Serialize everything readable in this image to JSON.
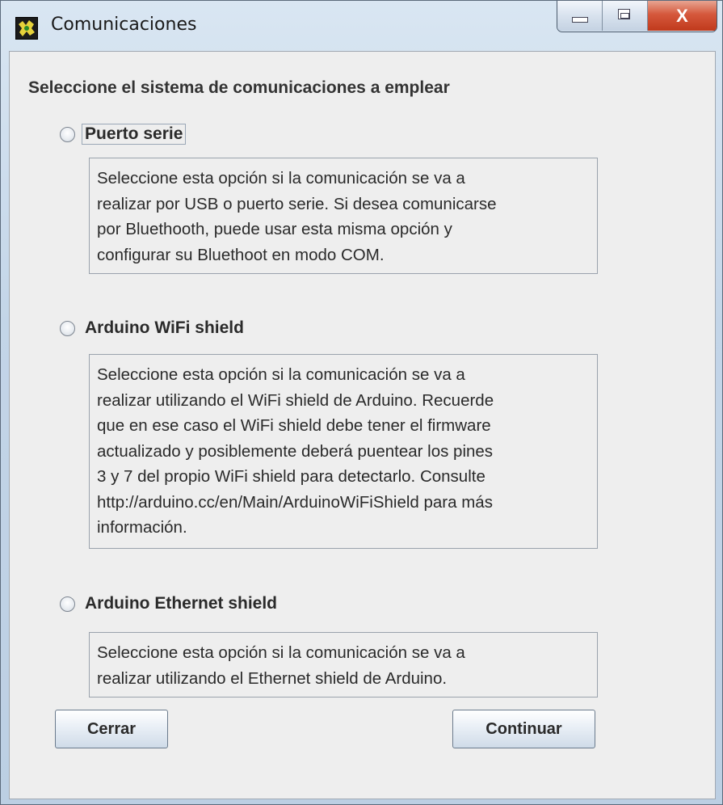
{
  "window": {
    "title": "Comunicaciones",
    "controls": {
      "close_label": "X"
    }
  },
  "dialog": {
    "heading": "Seleccione el sistema de comunicaciones a emplear",
    "options": [
      {
        "label": "Puerto serie",
        "selected": false,
        "description": "Seleccione esta opción si la comunicación se va a\nrealizar por USB o puerto serie. Si desea comunicarse\npor Bluethooth, puede usar esta misma opción y\nconfigurar su Bluethoot en modo COM."
      },
      {
        "label": "Arduino WiFi shield",
        "selected": false,
        "description": "Seleccione esta opción si la comunicación se va a\nrealizar utilizando el WiFi shield de Arduino. Recuerde\nque en ese caso el WiFi shield debe tener el firmware\nactualizado y posiblemente deberá puentear los pines\n3 y 7 del propio WiFi shield para detectarlo. Consulte\nhttp://arduino.cc/en/Main/ArduinoWiFiShield para más\ninformación."
      },
      {
        "label": "Arduino Ethernet shield",
        "selected": false,
        "description": "Seleccione esta opción si la comunicación se va a\nrealizar utilizando el Ethernet shield de Arduino."
      }
    ],
    "buttons": {
      "close": "Cerrar",
      "continue": "Continuar"
    }
  }
}
